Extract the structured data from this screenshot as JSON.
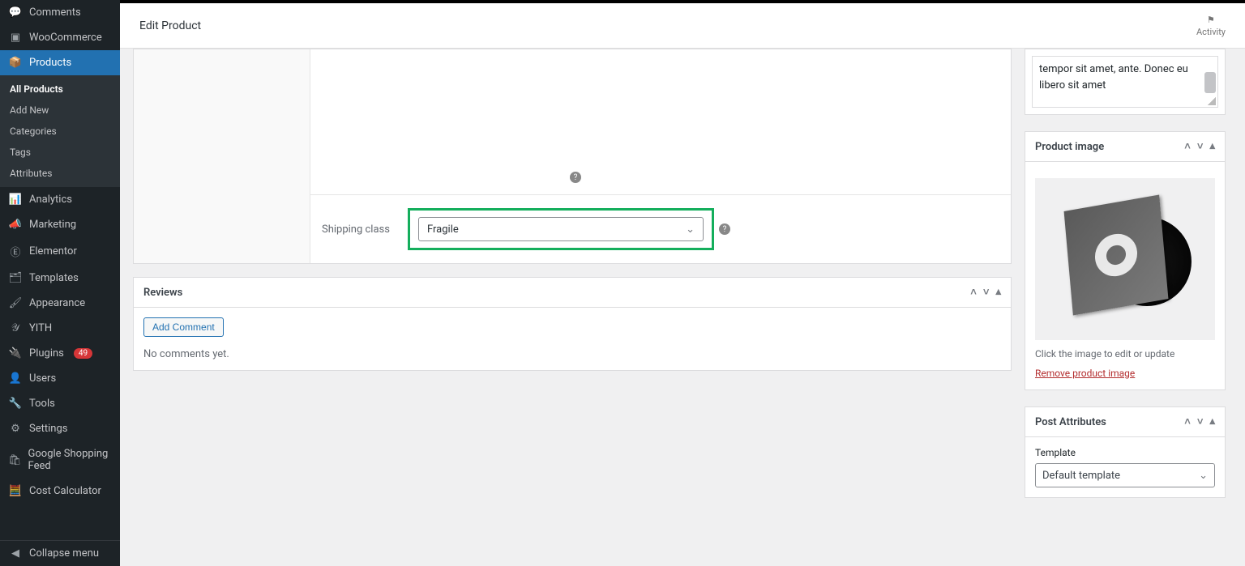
{
  "topbar": {
    "title": "Edit Product",
    "activity": "Activity"
  },
  "sidebar": {
    "items": [
      {
        "icon": "comment-icon",
        "label": "Comments"
      },
      {
        "icon": "woo-icon",
        "label": "WooCommerce"
      },
      {
        "icon": "products-icon",
        "label": "Products",
        "active": true
      },
      {
        "icon": "analytics-icon",
        "label": "Analytics"
      },
      {
        "icon": "marketing-icon",
        "label": "Marketing"
      },
      {
        "icon": "elementor-icon",
        "label": "Elementor"
      },
      {
        "icon": "templates-icon",
        "label": "Templates"
      },
      {
        "icon": "appearance-icon",
        "label": "Appearance"
      },
      {
        "icon": "yith-icon",
        "label": "YITH"
      },
      {
        "icon": "plugins-icon",
        "label": "Plugins",
        "badge": "49"
      },
      {
        "icon": "users-icon",
        "label": "Users"
      },
      {
        "icon": "tools-icon",
        "label": "Tools"
      },
      {
        "icon": "settings-icon",
        "label": "Settings"
      },
      {
        "icon": "shopping-icon",
        "label": "Google Shopping Feed"
      },
      {
        "icon": "calc-icon",
        "label": "Cost Calculator"
      }
    ],
    "submenu": [
      "All Products",
      "Add New",
      "Categories",
      "Tags",
      "Attributes"
    ],
    "collapse": "Collapse menu"
  },
  "shipping": {
    "label": "Shipping class",
    "value": "Fragile"
  },
  "reviews": {
    "heading": "Reviews",
    "add": "Add Comment",
    "empty": "No comments yet."
  },
  "excerpt": {
    "text_html": "tempor sit amet, ante. Donec eu libero sit amet"
  },
  "product_image": {
    "heading": "Product image",
    "caption": "Click the image to edit or update",
    "remove": "Remove product image"
  },
  "post_attributes": {
    "heading": "Post Attributes",
    "label": "Template",
    "value": "Default template"
  }
}
